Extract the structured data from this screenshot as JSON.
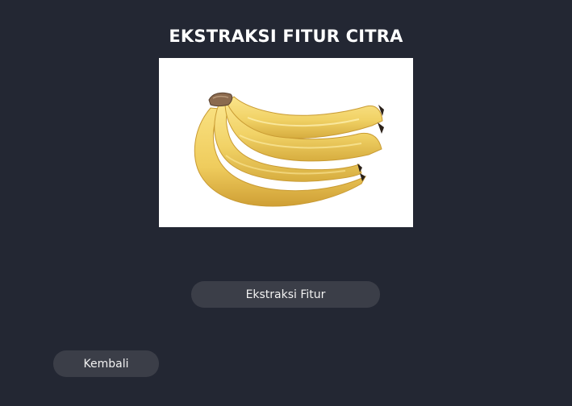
{
  "page": {
    "title": "EKSTRAKSI FITUR CITRA"
  },
  "image": {
    "subject": "banana"
  },
  "buttons": {
    "extract_label": "Ekstraksi Fitur",
    "back_label": "Kembali"
  },
  "colors": {
    "background": "#232733",
    "button": "#3b3e48",
    "banana": "#f3d66b"
  }
}
